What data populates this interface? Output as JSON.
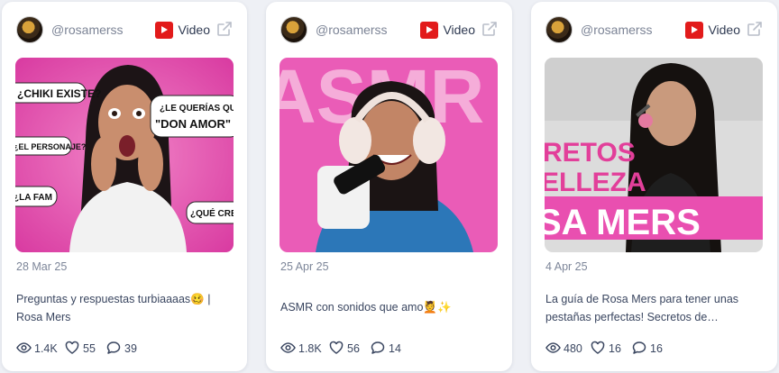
{
  "cards": [
    {
      "handle": "@rosamerss",
      "platform": "Video",
      "date": "28 Mar 25",
      "description": "Preguntas y respuestas turbiaaaas🥴 | Rosa Mers",
      "views": "1.4K",
      "likes": "55",
      "comments": "39",
      "thumb_text": [
        "¿CHIKI EXISTE?",
        "¿LE QUERÍAS QUE",
        "\"DON AMOR\" A",
        "¿EL PERSONAJE?",
        "¿LA FAM",
        "¿QUÉ CREA"
      ]
    },
    {
      "handle": "@rosamerss",
      "platform": "Video",
      "date": "25 Apr 25",
      "description": "ASMR con sonidos que amo💆✨",
      "views": "1.8K",
      "likes": "56",
      "comments": "14",
      "thumb_text": [
        "ASMR"
      ]
    },
    {
      "handle": "@rosamerss",
      "platform": "Video",
      "date": "4 Apr 25",
      "description": "La guía de Rosa Mers para tener unas pestañas perfectas! Secretos de…",
      "views": "480",
      "likes": "16",
      "comments": "16",
      "thumb_text": [
        "RETOS",
        "ELLEZA",
        "SA MERS"
      ]
    }
  ],
  "colors": {
    "brand_red": "#e21b1b",
    "thumb_pink": "#e94fb0",
    "thumb_purple": "#6b3fa8"
  },
  "icons": [
    "avatar",
    "youtube-icon",
    "external-link-icon",
    "eye-icon",
    "heart-icon",
    "comment-icon"
  ]
}
